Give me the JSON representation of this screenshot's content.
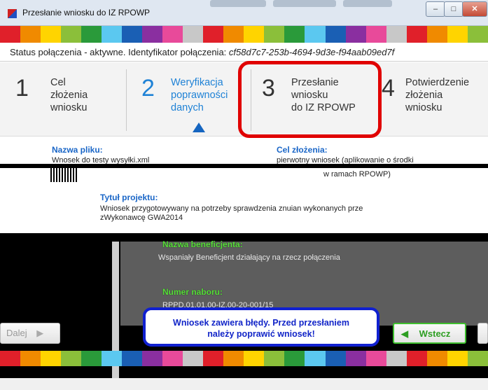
{
  "window": {
    "title": "Przesłanie wniosku do IZ RPOWP",
    "min_label": "–",
    "max_label": "□",
    "close_label": "✕"
  },
  "palette": [
    "#e0202a",
    "#f08a00",
    "#ffd400",
    "#8bbf3a",
    "#2a9a3a",
    "#5bc8f0",
    "#1a5fb4",
    "#8a2fa0",
    "#e84a9a",
    "#c8c8c8"
  ],
  "status": {
    "prefix": "Status połączenia - aktywne. Identyfikator połączenia: ",
    "connection_id": "cf58d7c7-253b-4694-9d3e-f94aab09ed7f"
  },
  "steps": [
    {
      "number": "1",
      "label": "Cel\nzłożenia\nwniosku"
    },
    {
      "number": "2",
      "label": "Weryfikacja\npoprawności\ndanych"
    },
    {
      "number": "3",
      "label": "Przesłanie\nwniosku\ndo IZ RPOWP"
    },
    {
      "number": "4",
      "label": "Potwierdzenie\nzłożenia\nwniosku"
    }
  ],
  "fields": {
    "file_name_label": "Nazwa pliku:",
    "file_name_value": "Wnosek do testy wysyłki.xml",
    "purpose_label": "Cel złożenia:",
    "purpose_value_line1": "pierwotny wniosek (aplikowanie o środki",
    "purpose_value_line2": "w ramach RPOWP)",
    "project_title_label": "Tytuł projektu:",
    "project_title_line1": "Wniosek przygotowywany na potrzeby sprawdzenia znuian wykonanych prze",
    "project_title_line2": "zWykonawcę GWA2014",
    "beneficiary_label": "Nazwa beneficjenta:",
    "beneficiary_value": "Wspaniały Beneficjent działający na rzecz połączenia",
    "call_number_label": "Numer naboru:",
    "call_number_value": "RPPD.01.01.00-IZ.00-20-001/15"
  },
  "buttons": {
    "next_label": "Dalej",
    "back_label": "Wstecz"
  },
  "warning": {
    "line1": "Wniosek zawiera błędy. Przed przesłaniem",
    "line2": "należy poprawić wniosek!"
  }
}
